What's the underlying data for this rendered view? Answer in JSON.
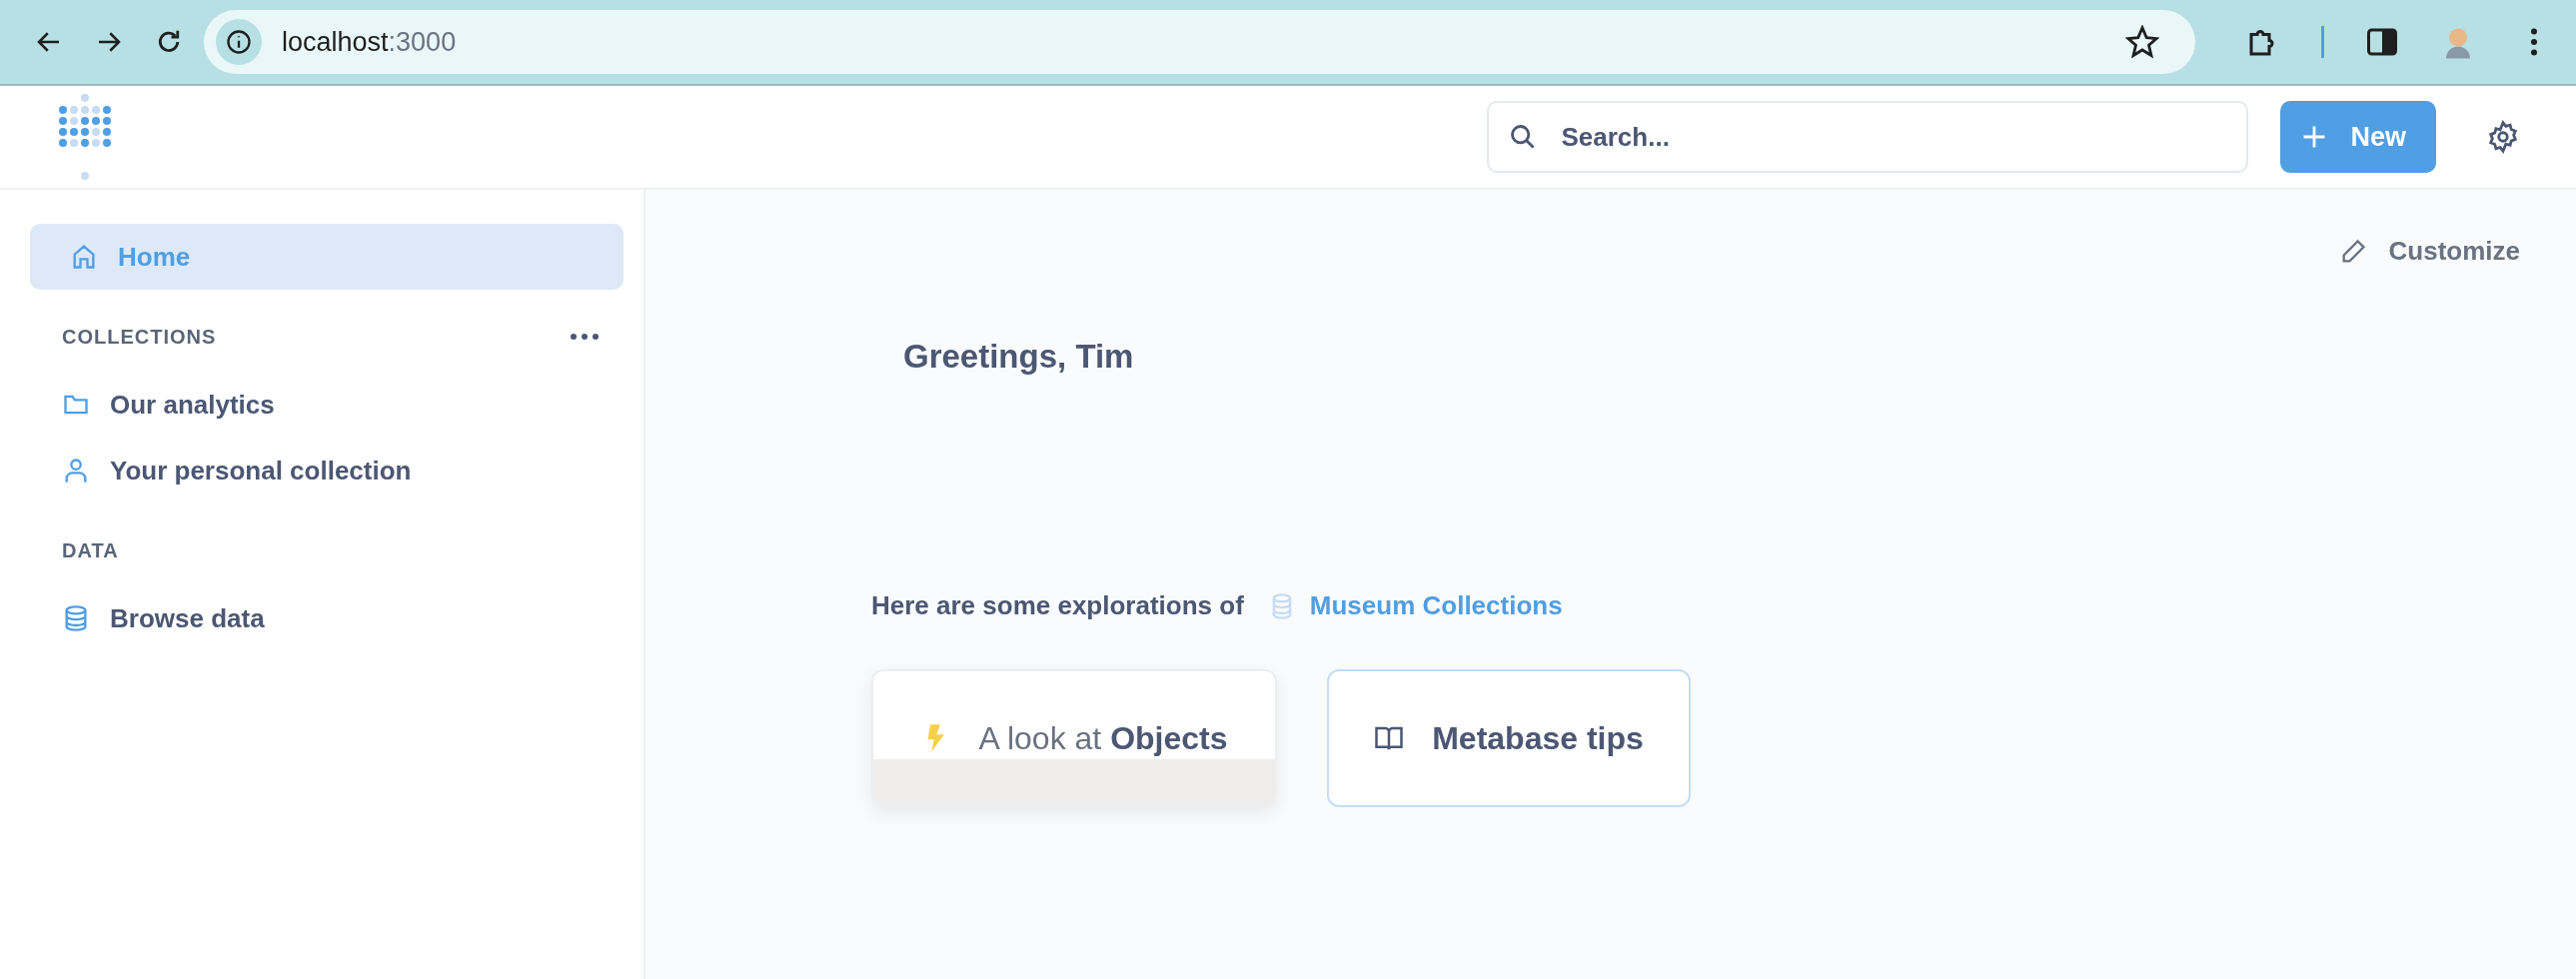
{
  "browser": {
    "url_host": "localhost",
    "url_port": ":3000"
  },
  "header": {
    "search": {
      "placeholder": "Search..."
    },
    "new_button": "New"
  },
  "sidebar": {
    "items": [
      {
        "label": "Home",
        "kind": "home",
        "selected": true
      }
    ],
    "sections": [
      {
        "title": "COLLECTIONS",
        "has_menu": true,
        "items": [
          {
            "label": "Our analytics",
            "kind": "folder",
            "selected": false
          },
          {
            "label": "Your personal collection",
            "kind": "person",
            "selected": false
          }
        ]
      },
      {
        "title": "DATA",
        "has_menu": false,
        "items": [
          {
            "label": "Browse data",
            "kind": "database",
            "selected": false
          }
        ]
      }
    ]
  },
  "main": {
    "customize": "Customize",
    "greeting": "Greetings, Tim",
    "explorations_text": "Here are some explorations of",
    "database_link": "Museum Collections",
    "cards": [
      {
        "kind": "xray",
        "label": "A look at **Objects**"
      },
      {
        "kind": "tips",
        "label": "Metabase tips"
      }
    ]
  }
}
